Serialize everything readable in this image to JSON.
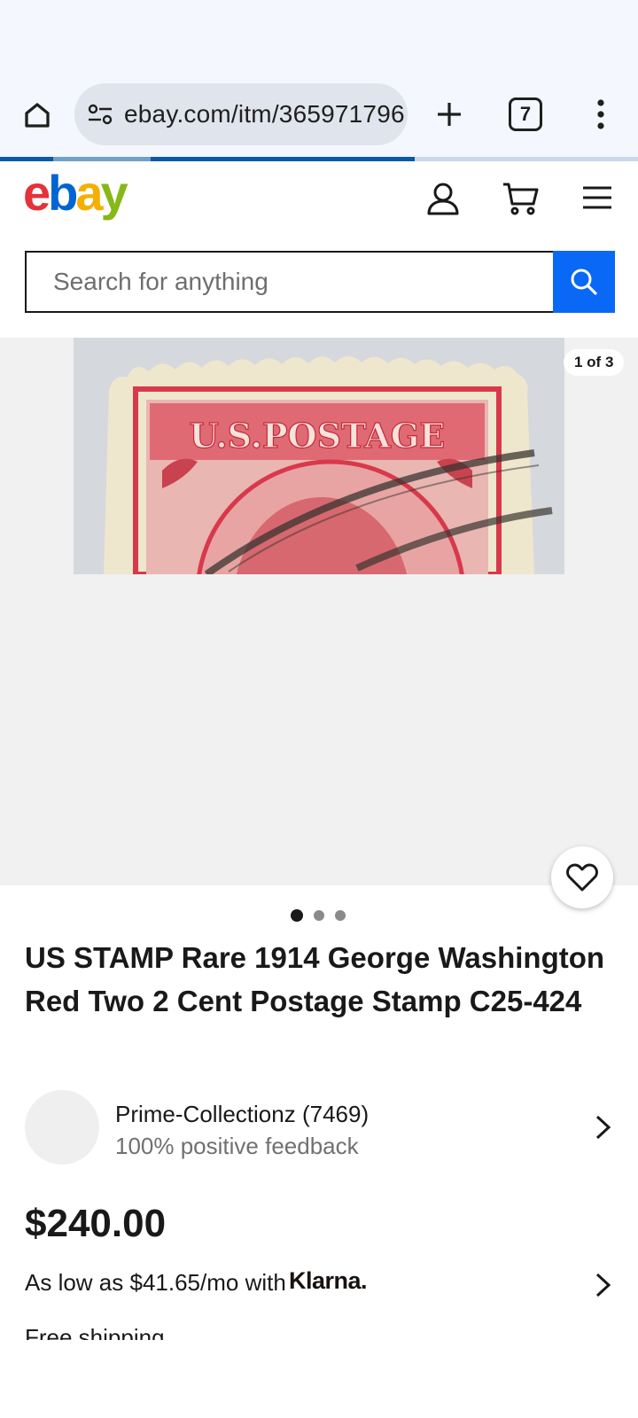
{
  "browser": {
    "url": "ebay.com/itm/365971796",
    "tab_count": "7",
    "load_progress_percent": 65
  },
  "ebay": {
    "logo_letters": [
      "e",
      "b",
      "a",
      "y"
    ],
    "search_placeholder": "Search for anything"
  },
  "gallery": {
    "counter": "1 of 3",
    "image_count": 3,
    "active_index": 0,
    "stamp_text": "U.S.POSTAGE"
  },
  "item": {
    "title": "US STAMP Rare 1914 George Washington Red Two 2 Cent Postage Stamp C25-424",
    "seller_name": "Prime-Collectionz (7469)",
    "seller_feedback": "100% positive feedback",
    "price": "$240.00",
    "financing_text": "As low as $41.65/mo with",
    "financing_brand": "Klarna.",
    "shipping": "Free shipping"
  },
  "colors": {
    "ebay_red": "#e53238",
    "ebay_blue": "#0064d2",
    "ebay_yellow": "#f5af02",
    "ebay_green": "#86b817",
    "search_button": "#0968f6",
    "stamp_red": "#d8394a"
  }
}
